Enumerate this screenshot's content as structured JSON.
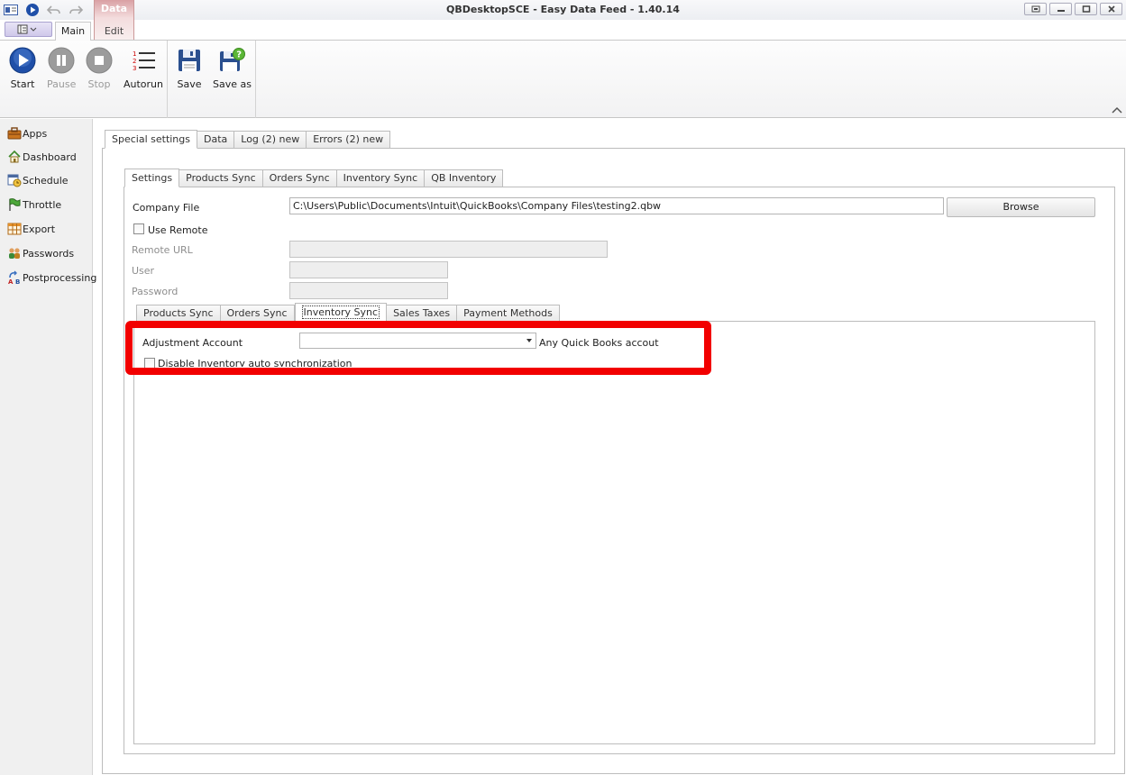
{
  "window": {
    "title": "QBDesktopSCE - Easy Data Feed - 1.40.14"
  },
  "ribbon": {
    "context_group": "Data",
    "tabs": {
      "main": "Main",
      "edit": "Edit"
    },
    "buttons": {
      "start": "Start",
      "pause": "Pause",
      "stop": "Stop",
      "autorun": "Autorun",
      "save": "Save",
      "save_as": "Save as"
    }
  },
  "sidebar": {
    "items": [
      "Apps",
      "Dashboard",
      "Schedule",
      "Throttle",
      "Export",
      "Passwords",
      "Postprocessing"
    ]
  },
  "outer_tabs": [
    "Special settings",
    "Data",
    "Log (2) new",
    "Errors (2) new"
  ],
  "settings_tabs": [
    "Settings",
    "Products Sync",
    "Orders Sync",
    "Inventory Sync",
    "QB Inventory"
  ],
  "settings": {
    "company_file_label": "Company File",
    "company_file_value": "C:\\Users\\Public\\Documents\\Intuit\\QuickBooks\\Company Files\\testing2.qbw",
    "browse_label": "Browse",
    "use_remote_label": "Use Remote",
    "remote_url_label": "Remote URL",
    "user_label": "User",
    "password_label": "Password"
  },
  "inner_tabs": [
    "Products Sync",
    "Orders Sync",
    "Inventory Sync",
    "Sales Taxes",
    "Payment Methods"
  ],
  "inventory": {
    "adjustment_account_label": "Adjustment Account",
    "adjustment_account_value": "",
    "hint": "Any Quick Books accout",
    "disable_auto_label": "Disable Inventory auto synchronization"
  },
  "colors": {
    "highlight": "#f20000",
    "context_tab": "#d9a0a4",
    "play_button": "#1f4fa8"
  }
}
